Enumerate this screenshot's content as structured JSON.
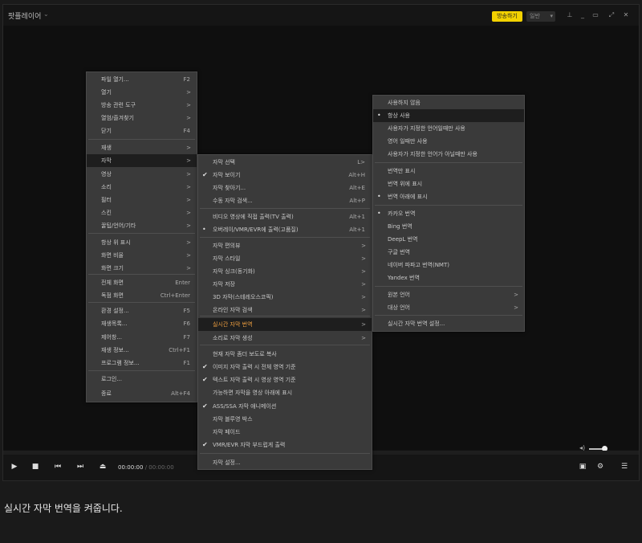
{
  "titlebar": {
    "app_title": "팟플레이어",
    "live_button": "방송하기",
    "quality_label": "일반"
  },
  "controls": {
    "time_current": "00:00:00",
    "time_total": "/ 00:00:00"
  },
  "main_menu": [
    {
      "label": "파일 열기...",
      "shortcut": "F2"
    },
    {
      "label": "열기",
      "arrow": ">"
    },
    {
      "label": "방송 관련 도구",
      "arrow": ">"
    },
    {
      "label": "열엄/즐겨찾기",
      "arrow": ">"
    },
    {
      "label": "닫기",
      "shortcut": "F4"
    },
    {
      "label": "재생",
      "arrow": ">"
    },
    {
      "label": "자막",
      "arrow": ">"
    },
    {
      "label": "영상",
      "arrow": ">"
    },
    {
      "label": "소리",
      "arrow": ">"
    },
    {
      "label": "필터",
      "arrow": ">"
    },
    {
      "label": "스킨",
      "arrow": ">"
    },
    {
      "label": "꿀팁/언어/기타",
      "arrow": ">"
    },
    {
      "label": "항상 위 표시",
      "arrow": ">"
    },
    {
      "label": "화면 비율",
      "arrow": ">"
    },
    {
      "label": "화면 크기",
      "arrow": ">"
    },
    {
      "label": "전체 화면",
      "shortcut": "Enter"
    },
    {
      "label": "독점 화면",
      "shortcut": "Ctrl+Enter"
    },
    {
      "label": "환경 설정...",
      "shortcut": "F5"
    },
    {
      "label": "재생목록...",
      "shortcut": "F6"
    },
    {
      "label": "제어창...",
      "shortcut": "F7"
    },
    {
      "label": "재생 정보...",
      "shortcut": "Ctrl+F1"
    },
    {
      "label": "프로그램 정보...",
      "shortcut": "F1"
    },
    {
      "label": "로그인..."
    },
    {
      "label": "종료",
      "shortcut": "Alt+F4"
    }
  ],
  "subtitle_menu": [
    {
      "label": "자막 선택",
      "shortcut": "L>"
    },
    {
      "label": "자막 보이기",
      "shortcut": "Alt+H",
      "check": "✔"
    },
    {
      "label": "자막 찾아기...",
      "shortcut": "Alt+E"
    },
    {
      "label": "수동 자막 검색...",
      "shortcut": "Alt+P"
    },
    {
      "label": "비디오 영상에 직접 출력(TV 출력)",
      "shortcut": "Alt+1"
    },
    {
      "label": "오버레이/VMR/EVR에 출력(고품질)",
      "shortcut": "Alt+1",
      "check": "•"
    },
    {
      "label": "자막 편의뷰",
      "arrow": ">"
    },
    {
      "label": "자막 스타일",
      "arrow": ">"
    },
    {
      "label": "자막 싱크(동기화)",
      "arrow": ">"
    },
    {
      "label": "자막 저장",
      "arrow": ">"
    },
    {
      "label": "3D 자막(스테레오스코픽)",
      "arrow": ">"
    },
    {
      "label": "온라인 자막 검색",
      "arrow": ">"
    },
    {
      "label": "실시간 자막 번역",
      "arrow": ">"
    },
    {
      "label": "소리로 자막 생성",
      "arrow": ">"
    },
    {
      "label": "현재 자막 좀더 보도로 복사"
    },
    {
      "label": "이미지 자막 출력 시 전체 영역 기준",
      "check": "✔"
    },
    {
      "label": "텍스트 자막 출력 시 영상 영역 기준",
      "check": "✔"
    },
    {
      "label": "가능하면 자막을 영상 아래에 표시"
    },
    {
      "label": "ASS/SSA 자막 애니메이션",
      "check": "✔"
    },
    {
      "label": "자막 블루영 박스"
    },
    {
      "label": "자막 페이드"
    },
    {
      "label": "VMR/EVR 자막 부드럽게 출력",
      "check": "✔"
    },
    {
      "label": "자막 설정..."
    }
  ],
  "translate_menu": [
    {
      "label": "사용하지 않음"
    },
    {
      "label": "항상 사용",
      "check": "•"
    },
    {
      "label": "사용자가 지정한 언어일때만 사용"
    },
    {
      "label": "영어 일때만 사용"
    },
    {
      "label": "사용자가 지정한 언어가 아닐때만 사용"
    },
    {
      "label": "번역만 표시"
    },
    {
      "label": "번역 위에 표시"
    },
    {
      "label": "번역 아래에 표시",
      "check": "•"
    },
    {
      "label": "카카오 번역",
      "check": "•"
    },
    {
      "label": "Bing 번역"
    },
    {
      "label": "DeepL 번역"
    },
    {
      "label": "구글 번역"
    },
    {
      "label": "네이버 파파고 번역(NMT)"
    },
    {
      "label": "Yandex 번역"
    },
    {
      "label": "원본 언어",
      "arrow": ">"
    },
    {
      "label": "대상 언어",
      "arrow": ">"
    },
    {
      "label": "실시간 자막 번역 설정..."
    }
  ],
  "caption": "실시간 자막 번역을 켜줍니다."
}
